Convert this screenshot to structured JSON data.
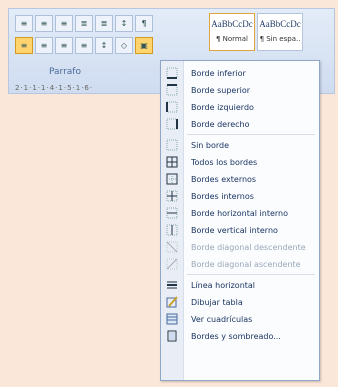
{
  "ribbon": {
    "group_label": "Parrafo",
    "ruler_text": "2·1·1·1·4·1·5·1·6·",
    "styles": [
      {
        "sample": "AaBbCcDc",
        "name": "¶ Normal"
      },
      {
        "sample": "AaBbCcDc",
        "name": "¶ Sin espa.."
      }
    ],
    "row1_icons": [
      "≡",
      "≡",
      "≡",
      "≣",
      "≣",
      "↕",
      "¶"
    ],
    "row2_icons": [
      "≡",
      "≡",
      "≡",
      "≡",
      "↕",
      "◇",
      "▣"
    ]
  },
  "menu": {
    "items": [
      {
        "label": "Borde inferior",
        "icon": "border-bottom-icon"
      },
      {
        "label": "Borde superior",
        "icon": "border-top-icon"
      },
      {
        "label": "Borde izquierdo",
        "icon": "border-left-icon"
      },
      {
        "label": "Borde derecho",
        "icon": "border-right-icon"
      },
      {
        "label": "Sin borde",
        "icon": "no-border-icon"
      },
      {
        "label": "Todos los bordes",
        "icon": "all-borders-icon"
      },
      {
        "label": "Bordes externos",
        "icon": "outside-borders-icon"
      },
      {
        "label": "Bordes internos",
        "icon": "inside-borders-icon"
      },
      {
        "label": "Borde horizontal interno",
        "icon": "inside-horizontal-border-icon"
      },
      {
        "label": "Borde vertical interno",
        "icon": "inside-vertical-border-icon"
      },
      {
        "label": "Borde diagonal descendente",
        "icon": "diagonal-down-border-icon",
        "disabled": true
      },
      {
        "label": "Borde diagonal ascendente",
        "icon": "diagonal-up-border-icon",
        "disabled": true
      },
      {
        "label": "Línea horizontal",
        "icon": "horizontal-line-icon"
      },
      {
        "label": "Dibujar tabla",
        "icon": "draw-table-icon"
      },
      {
        "label": "Ver cuadrículas",
        "icon": "view-gridlines-icon"
      },
      {
        "label": "Bordes y sombreado...",
        "icon": "borders-shading-icon"
      }
    ]
  }
}
